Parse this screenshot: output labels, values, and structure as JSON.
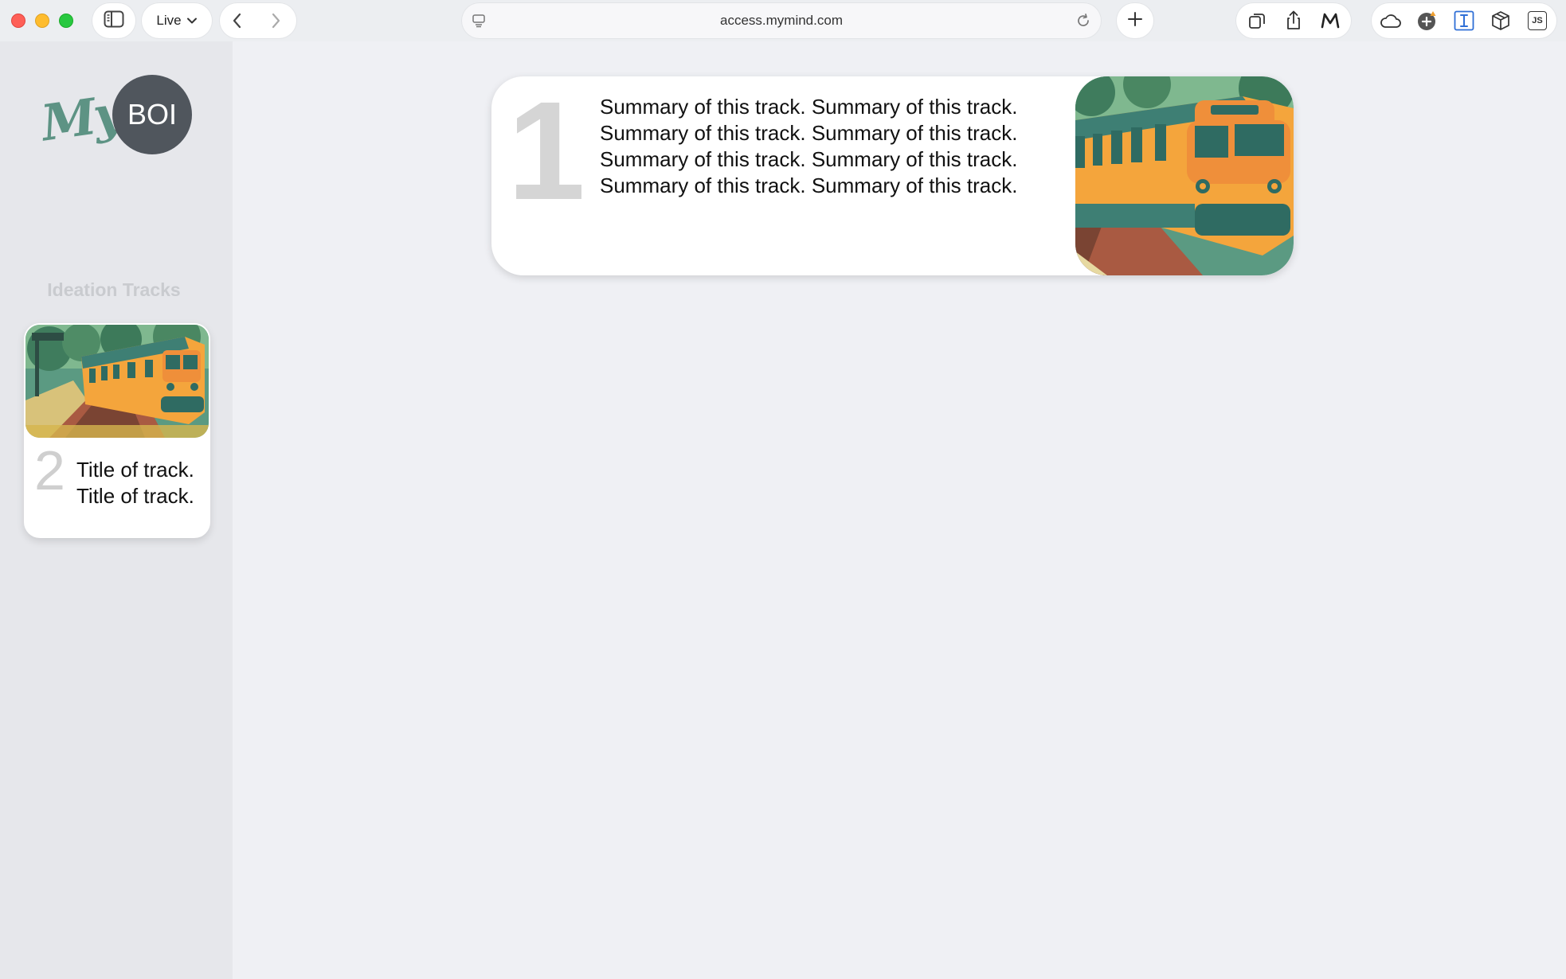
{
  "browser": {
    "live_label": "Live",
    "url": "access.mymind.com",
    "extension_js_label": "JS"
  },
  "app": {
    "logo_word": "My",
    "avatar_initials": "BOI"
  },
  "sidebar": {
    "section_title": "Ideation Tracks",
    "tracks": [
      {
        "number": "2",
        "title": "Title of track. Title of track."
      }
    ]
  },
  "main": {
    "track": {
      "number": "1",
      "summary": "Summary of this track. Summary of this track. Summary of this track. Summary of this track. Summary of this track. Summary of this track. Summary of this track. Summary of this track."
    }
  }
}
